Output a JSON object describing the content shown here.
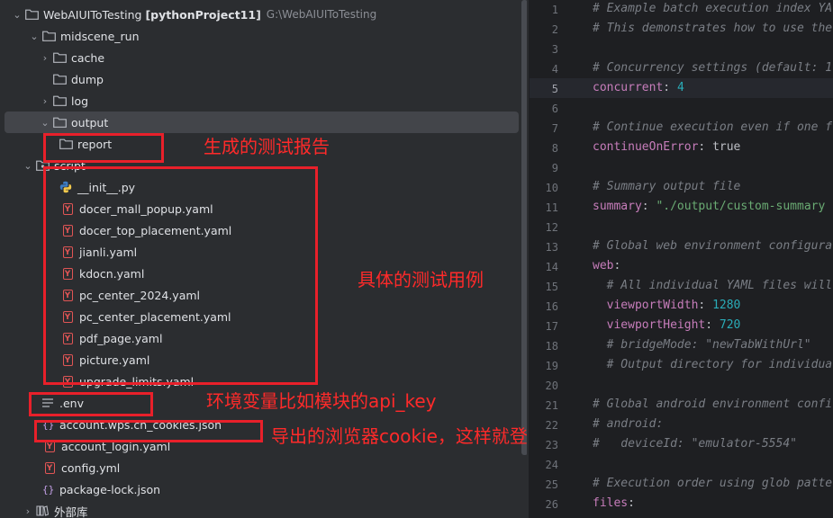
{
  "project": {
    "name": "WebAIUIToTesting",
    "module": "[pythonProject11]",
    "path": "G:\\WebAIUIToTesting"
  },
  "tree": {
    "midscene_run": "midscene_run",
    "cache": "cache",
    "dump": "dump",
    "log": "log",
    "output": "output",
    "report": "report",
    "script": "script",
    "init_py": "__init__.py",
    "files": [
      "docer_mall_popup.yaml",
      "docer_top_placement.yaml",
      "jianli.yaml",
      "kdocn.yaml",
      "pc_center_2024.yaml",
      "pc_center_placement.yaml",
      "pdf_page.yaml",
      "picture.yaml",
      "upgrade_limits.yaml"
    ],
    "env": ".env",
    "cookies": "account.wps.cn_cookies.json",
    "account_login": "account_login.yaml",
    "config": "config.yml",
    "package_lock": "package-lock.json",
    "external": "外部库"
  },
  "annotations": {
    "report": "生成的测试报告",
    "cases": "具体的测试用例",
    "env": "环境变量比如模块的api_key",
    "cookies": "导出的浏览器cookie，这样就登录账号可以直接访问"
  },
  "editor": {
    "lines": [
      {
        "n": "1",
        "t": "# Example batch execution index YA",
        "k": "com"
      },
      {
        "n": "2",
        "t": "# This demonstrates how to use the",
        "k": "com"
      },
      {
        "n": "3",
        "t": "",
        "k": "blank"
      },
      {
        "n": "4",
        "t": "# Concurrency settings (default: 1",
        "k": "com"
      },
      {
        "n": "5",
        "key": "concurrent",
        "val": "4",
        "vk": "num"
      },
      {
        "n": "6",
        "t": "",
        "k": "blank"
      },
      {
        "n": "7",
        "t": "# Continue execution even if one f",
        "k": "com"
      },
      {
        "n": "8",
        "key": "continueOnError",
        "val": "true",
        "vk": "plain"
      },
      {
        "n": "9",
        "t": "",
        "k": "blank"
      },
      {
        "n": "10",
        "t": "# Summary output file",
        "k": "com"
      },
      {
        "n": "11",
        "key": "summary",
        "val": "\"./output/custom-summary",
        "vk": "str"
      },
      {
        "n": "12",
        "t": "",
        "k": "blank"
      },
      {
        "n": "13",
        "t": "# Global web environment configura",
        "k": "com"
      },
      {
        "n": "14",
        "key": "web",
        "val": "",
        "vk": "plain"
      },
      {
        "n": "15",
        "t": "  # All individual YAML files will",
        "k": "com"
      },
      {
        "n": "16",
        "key": "  viewportWidth",
        "val": "1280",
        "vk": "num"
      },
      {
        "n": "17",
        "key": "  viewportHeight",
        "val": "720",
        "vk": "num"
      },
      {
        "n": "18",
        "t": "  # bridgeMode: \"newTabWithUrl\"",
        "k": "com"
      },
      {
        "n": "19",
        "t": "  # Output directory for individua",
        "k": "com"
      },
      {
        "n": "20",
        "t": "",
        "k": "blank"
      },
      {
        "n": "21",
        "t": "# Global android environment confi",
        "k": "com"
      },
      {
        "n": "22",
        "t": "# android:",
        "k": "com"
      },
      {
        "n": "23",
        "t": "#   deviceId: \"emulator-5554\"",
        "k": "com"
      },
      {
        "n": "24",
        "t": "",
        "k": "blank"
      },
      {
        "n": "25",
        "t": "# Execution order using glob patte",
        "k": "com"
      },
      {
        "n": "26",
        "key": "files",
        "val": "",
        "vk": "plain"
      }
    ]
  },
  "colors": {
    "annotation": "#e8202a",
    "background": "#2b2d30",
    "editor_bg": "#1e1f22",
    "selection": "#43454a"
  }
}
